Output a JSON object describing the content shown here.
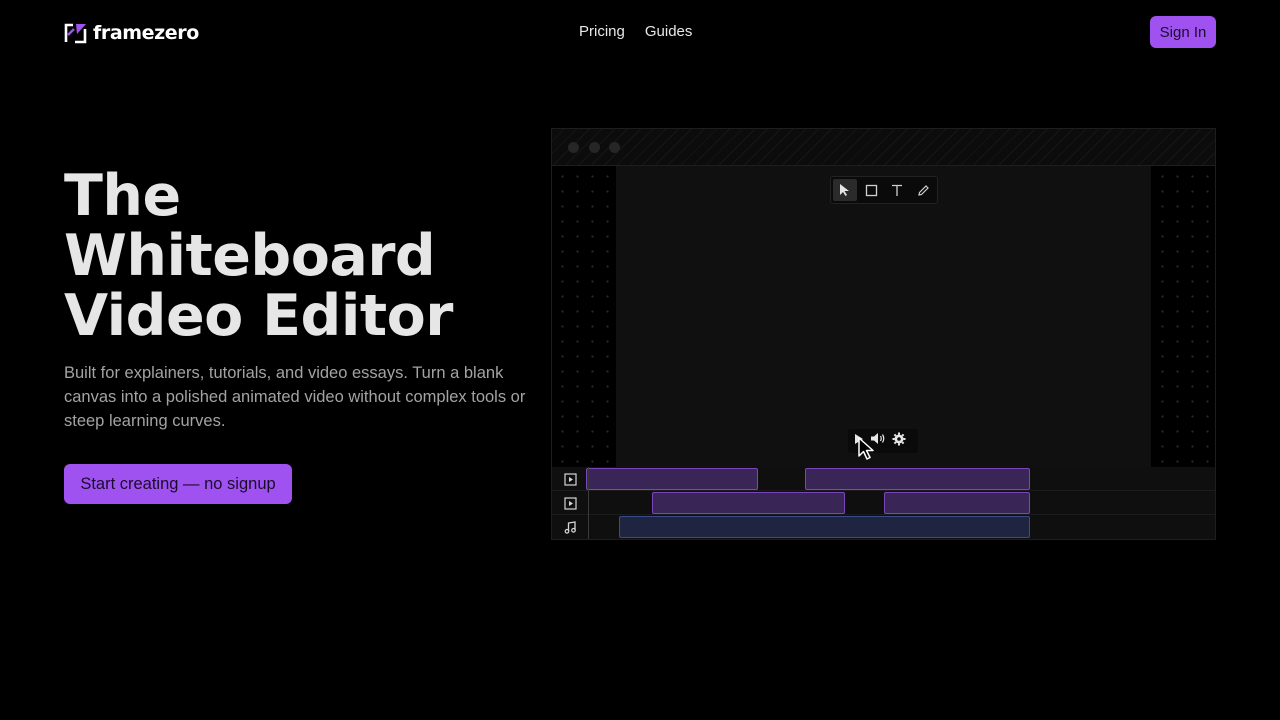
{
  "brand": {
    "name": "framezero",
    "accent": "#a052f0"
  },
  "nav": {
    "items": [
      {
        "label": "Pricing"
      },
      {
        "label": "Guides"
      }
    ]
  },
  "header": {
    "signin_label": "Sign In"
  },
  "hero": {
    "title_lines": [
      "The",
      "Whiteboard",
      "Video Editor"
    ],
    "subtitle": "Built for explainers, tutorials, and video essays. Turn a blank canvas into a polished animated video without complex tools or steep learning curves.",
    "cta_label": "Start creating — no signup"
  },
  "editor": {
    "tools": [
      "pointer-icon",
      "rectangle-icon",
      "text-icon",
      "pencil-icon"
    ],
    "active_tool": "pointer-icon",
    "player_controls": [
      "play-icon",
      "volume-icon",
      "settings-icon"
    ],
    "tracks": [
      {
        "type": "video",
        "icon": "video-track-icon"
      },
      {
        "type": "video",
        "icon": "video-track-icon"
      },
      {
        "type": "audio",
        "icon": "music-note-icon"
      }
    ],
    "colors": {
      "video_clip": "#3a2557",
      "audio_clip": "#1f2440"
    }
  }
}
